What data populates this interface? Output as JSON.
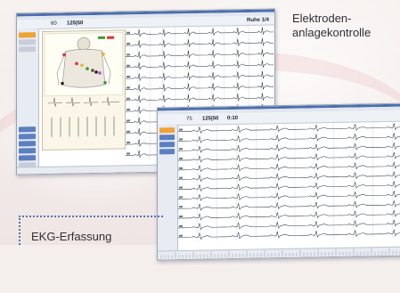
{
  "labels": {
    "electrode_check_line1": "Elektroden-",
    "electrode_check_line2": "anlagekontrolle",
    "ecg_capture": "EKG-Erfassung"
  },
  "screen1": {
    "header_left": "60",
    "header_value": "125|50",
    "header_right": "Ruhe 1/4"
  },
  "screen2": {
    "header_left": "75",
    "header_value": "125|50",
    "header_time": "0:10"
  },
  "colors": {
    "accent_orange": "#f0a334",
    "sidebar_blue": "#5b7fc1",
    "dotted_blue": "#5b6fb8"
  }
}
